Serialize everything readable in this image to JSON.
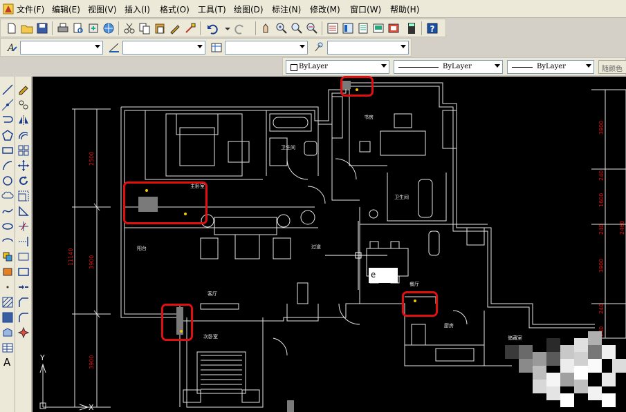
{
  "menu": {
    "items": [
      "文件(F)",
      "编辑(E)",
      "视图(V)",
      "插入(I)",
      "格式(O)",
      "工具(T)",
      "绘图(D)",
      "标注(N)",
      "修改(M)",
      "窗口(W)",
      "帮助(H)"
    ]
  },
  "properties": {
    "color_value": "ByLayer",
    "linetype_value": "ByLayer",
    "lineweight_value": "ByLayer",
    "plotstyle_value": "随颜色"
  },
  "command": {
    "dynamic_input": "e"
  },
  "ucs": {
    "y_label": "Y",
    "x_label": "X"
  },
  "drawing": {
    "rooms": {
      "master_bedroom": "主卧室",
      "study": "书房",
      "bathroom_1": "卫生间",
      "bathroom_2": "卫生间",
      "living_room": "客厅",
      "restaurant": "餐厅",
      "aisle": "过道",
      "kitchen": "厨房",
      "second_bedroom": "次卧室",
      "balcony": "阳台",
      "storage": "储藏室"
    },
    "dimensions_left": [
      "2500",
      "3900",
      "11140",
      "3900"
    ],
    "dimensions_right": [
      "3900",
      "240",
      "1600",
      "240",
      "3900",
      "240",
      "2460",
      "240"
    ]
  },
  "colors": {
    "menubar_bg": "#ece9d8",
    "canvas_bg": "#000000",
    "highlight": "#e01010",
    "dimension": "#e01010",
    "wall": "#e6e6e6"
  }
}
